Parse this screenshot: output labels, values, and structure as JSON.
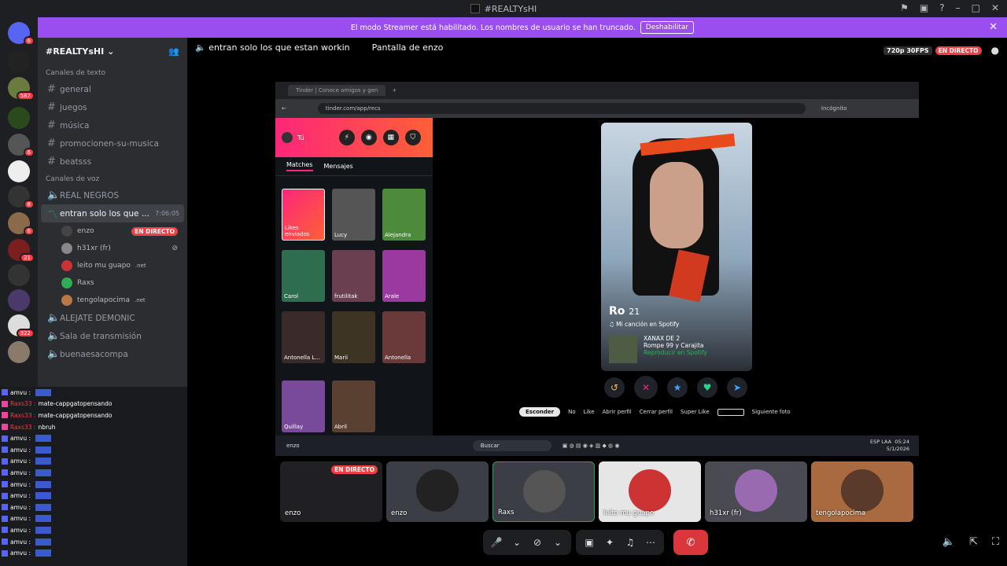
{
  "window": {
    "title": "#REALTYsHI"
  },
  "banner": {
    "text": "El modo Streamer está habilitado. Los nombres de usuario se han truncado.",
    "button": "Deshabilitar"
  },
  "servers": {
    "badges": [
      "6",
      "587",
      "6",
      "8",
      "6",
      "21",
      "322"
    ]
  },
  "guild": {
    "name": "#REALTYsHI"
  },
  "sidebar": {
    "text_category": "Canales de texto",
    "text_channels": [
      "general",
      "juegos",
      "música",
      "promocionen-su-musica",
      "beatsss"
    ],
    "voice_category": "Canales de voz",
    "voice_channels": {
      "real_negros": "REAL NEGROS",
      "active": "entran solo los que ...",
      "active_time": "7:06:05",
      "alejate": "ALEJATE DEMONIC",
      "sala": "Sala de transmisión",
      "buenaesa": "buenaesacompa"
    },
    "voice_users": [
      {
        "name": "enzo",
        "badge": "EN DIRECTO"
      },
      {
        "name": "h31xr (fr)"
      },
      {
        "name": "leito mu guapo",
        "tag": ".net"
      },
      {
        "name": "Raxs"
      },
      {
        "name": "tengolapocima",
        "tag": ".net"
      }
    ]
  },
  "chat": [
    {
      "name": "amvu :",
      "msg": ""
    },
    {
      "name": "Raxs33 :",
      "msg": "mate-cappgatopensando"
    },
    {
      "name": "Raxs33 :",
      "msg": "mate-cappgatopensando"
    },
    {
      "name": "Raxs33 :",
      "msg": "nbruh"
    },
    {
      "name": "amvu :",
      "msg": ""
    },
    {
      "name": "amvu :",
      "msg": ""
    },
    {
      "name": "amvu :",
      "msg": ""
    },
    {
      "name": "amvu :",
      "msg": ""
    },
    {
      "name": "amvu :",
      "msg": ""
    },
    {
      "name": "amvu :",
      "msg": ""
    },
    {
      "name": "amvu :",
      "msg": ""
    },
    {
      "name": "amvu :",
      "msg": ""
    },
    {
      "name": "amvu :",
      "msg": ""
    },
    {
      "name": "amvu :",
      "msg": ""
    },
    {
      "name": "amvu :",
      "msg": ""
    }
  ],
  "stage": {
    "channel": "entran solo los que estan workin",
    "screen_label": "Pantalla de enzo",
    "quality": "720p 30FPS",
    "live": "EN DIRECTO"
  },
  "shared_screen": {
    "tab_title": "Tinder | Conoce amigos y gen",
    "url": "tinder.com/app/recs",
    "incognito": "Incógnito",
    "user_label": "Tú",
    "tabs": [
      "Matches",
      "Mensajes"
    ],
    "likes_label": "Likes enviados",
    "tiles": [
      "Lucy",
      "Alejandra",
      "Carol",
      "frutilitak",
      "Arale",
      "Antonella L...",
      "Marii",
      "Antonella",
      "Quillay",
      "Abril"
    ],
    "profile_name": "Ro",
    "profile_age": "21",
    "song_label": "Mi canción en Spotify",
    "song_title": "XANAX DE 2",
    "song_artist": "Rompe 99 y Carajita",
    "song_play": "Reproducir en Spotify",
    "shortcuts": [
      "Esconder",
      "No",
      "Like",
      "Abrir perfil",
      "Cerrar perfil",
      "Super Like",
      "Siguiente foto"
    ],
    "taskbar_search": "Buscar",
    "taskbar_lang": "ESP LAA",
    "taskbar_time": "05:24",
    "taskbar_date": "5/1/2026",
    "corner_name": "enzo"
  },
  "participants": [
    {
      "name": "enzo",
      "live": "EN DIRECTO"
    },
    {
      "name": "enzo"
    },
    {
      "name": "Raxs"
    },
    {
      "name": "leito mu guapo"
    },
    {
      "name": "h31xr (fr)"
    },
    {
      "name": "tengolapocima"
    }
  ],
  "colors": {
    "accent": "#5865f2",
    "banner": "#9b4ef0",
    "live": "#f23f43",
    "end_call": "#da373c"
  }
}
